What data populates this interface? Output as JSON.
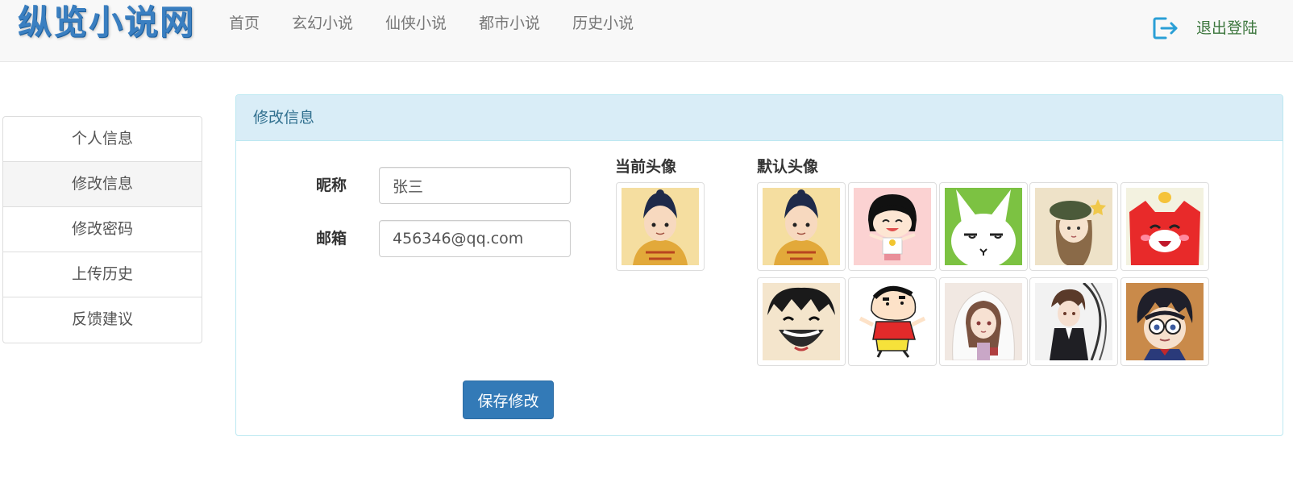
{
  "brand": "纵览小说网",
  "nav": {
    "links": [
      "首页",
      "玄幻小说",
      "仙侠小说",
      "都市小说",
      "历史小说"
    ],
    "logout_label": "退出登陆"
  },
  "sidebar": {
    "items": [
      "个人信息",
      "修改信息",
      "修改密码",
      "上传历史",
      "反馈建议"
    ],
    "active_index": 1
  },
  "panel": {
    "title": "修改信息",
    "nickname_label": "昵称",
    "nickname_value": "张三",
    "email_label": "邮箱",
    "email_value": "456346@qq.com",
    "current_avatar_label": "当前头像",
    "default_avatars_label": "默认头像",
    "save_label": "保存修改"
  },
  "avatars": {
    "current": "emperor-avatar",
    "defaults": [
      "emperor-avatar",
      "chibi-maruko-avatar",
      "rabbit-avatar",
      "beret-girl-avatar",
      "red-fox-avatar",
      "luffy-avatar",
      "shinchan-avatar",
      "hooded-girl-avatar",
      "dark-haired-boy-avatar",
      "conan-avatar"
    ]
  },
  "colors": {
    "primary": "#337ab7",
    "brand": "#3a7fc1",
    "panel_heading_bg": "#d9edf7",
    "panel_heading_text": "#31708f",
    "logout": "#3c763d",
    "logout_icon": "#2a9fd6"
  }
}
